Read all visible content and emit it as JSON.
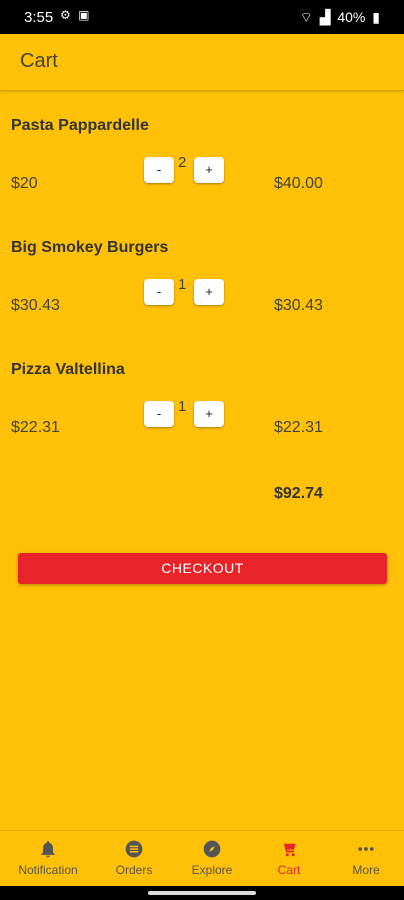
{
  "status_bar": {
    "time": "3:55",
    "battery": "40%",
    "icons": [
      "notification-icon",
      "gallery-icon",
      "wifi-icon",
      "signal-icon",
      "battery-icon"
    ]
  },
  "app_bar": {
    "title": "Cart"
  },
  "cart": {
    "items": [
      {
        "name": "Pasta Pappardelle",
        "unit_price": "$20",
        "minus_label": "-",
        "quantity": "2",
        "plus_label": "+",
        "line_total": "$40.00"
      },
      {
        "name": "Big Smokey Burgers",
        "unit_price": "$30.43",
        "minus_label": "-",
        "quantity": "1",
        "plus_label": "+",
        "line_total": "$30.43"
      },
      {
        "name": "Pizza Valtellina",
        "unit_price": "$22.31",
        "minus_label": "-",
        "quantity": "1",
        "plus_label": "+",
        "line_total": "$22.31"
      }
    ],
    "grand_total": "$92.74",
    "checkout_label": "CHECKOUT"
  },
  "bottom_nav": {
    "items": [
      {
        "label": "Notification",
        "icon": "bell-icon"
      },
      {
        "label": "Orders",
        "icon": "orders-icon"
      },
      {
        "label": "Explore",
        "icon": "compass-icon"
      },
      {
        "label": "Cart",
        "icon": "cart-icon",
        "active": true
      },
      {
        "label": "More",
        "icon": "more-icon"
      }
    ]
  },
  "colors": {
    "background": "#FFC107",
    "checkout": "#E8232A",
    "active_nav": "#E8232A"
  }
}
